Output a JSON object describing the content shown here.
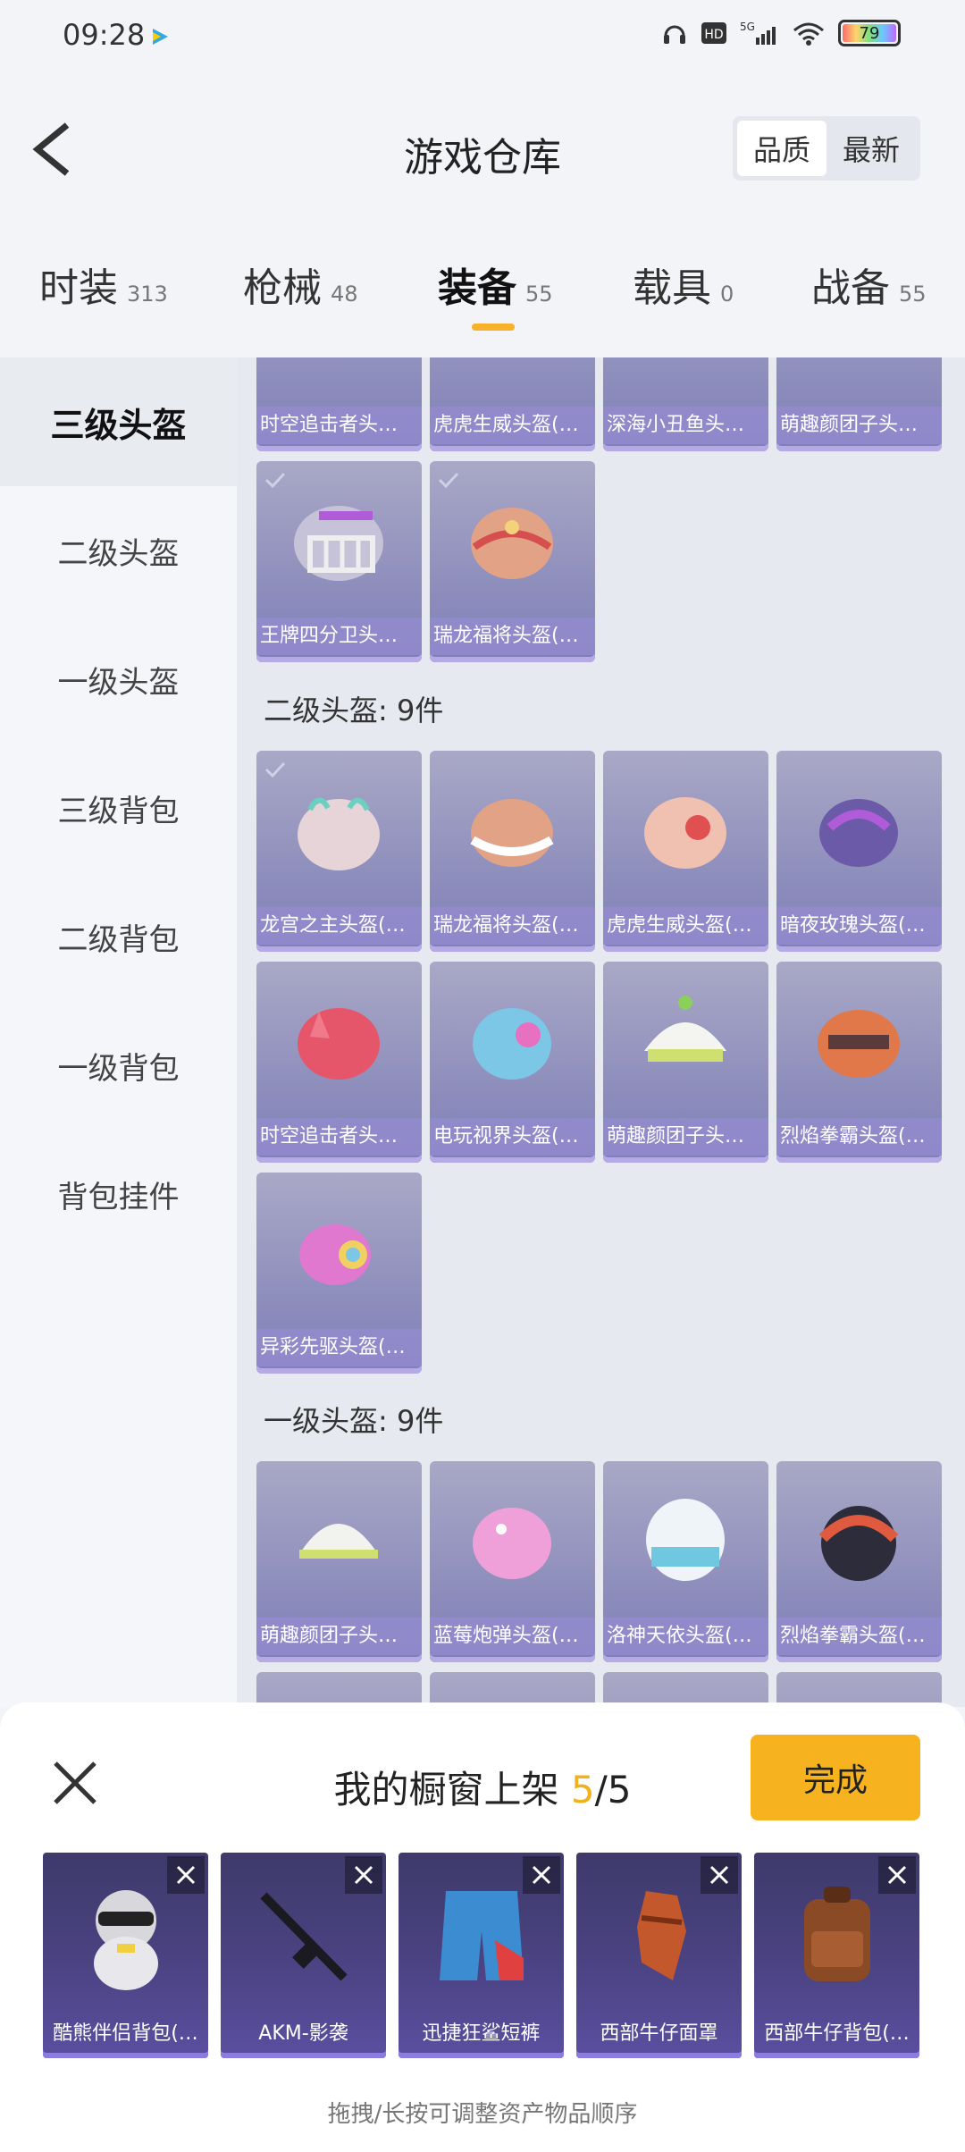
{
  "status": {
    "time": "09:28",
    "battery": "79",
    "network": "5G"
  },
  "header": {
    "title": "游戏仓库",
    "sort_quality": "品质",
    "sort_latest": "最新"
  },
  "tabs": [
    {
      "label": "时装",
      "count": "313"
    },
    {
      "label": "枪械",
      "count": "48"
    },
    {
      "label": "装备",
      "count": "55"
    },
    {
      "label": "载具",
      "count": "0"
    },
    {
      "label": "战备",
      "count": "55"
    }
  ],
  "side_menu": [
    "三级头盔",
    "二级头盔",
    "一级头盔",
    "三级背包",
    "二级背包",
    "一级背包",
    "背包挂件"
  ],
  "sections": {
    "top_row": [
      "时空追击者头…",
      "虎虎生威头盔(…",
      "深海小丑鱼头…",
      "萌趣颜团子头…"
    ],
    "level3_rest": [
      "王牌四分卫头…",
      "瑞龙福将头盔(…"
    ],
    "level2_title": "二级头盔: 9件",
    "level2_items": [
      "龙宫之主头盔(…",
      "瑞龙福将头盔(…",
      "虎虎生威头盔(…",
      "暗夜玫瑰头盔(…",
      "时空追击者头…",
      "电玩视界头盔(…",
      "萌趣颜团子头…",
      "烈焰拳霸头盔(…",
      "异彩先驱头盔(…"
    ],
    "level1_title": "一级头盔: 9件",
    "level1_items": [
      "萌趣颜团子头…",
      "蓝莓炮弹头盔(…",
      "洛神天依头盔(…",
      "烈焰拳霸头盔(…"
    ]
  },
  "sheet": {
    "title": "我的橱窗上架",
    "selected": "5",
    "total": "/5",
    "done_label": "完成",
    "hint": "拖拽/长按可调整资产物品顺序",
    "items": [
      "酷熊伴侣背包(…",
      "AKM-影袭",
      "迅捷狂鲨短裤",
      "西部牛仔面罩",
      "西部牛仔背包(…"
    ]
  },
  "colors": {
    "accent": "#f7b21f",
    "card_bg": "#8f8fbd",
    "slot_bg": "#4b4383"
  }
}
